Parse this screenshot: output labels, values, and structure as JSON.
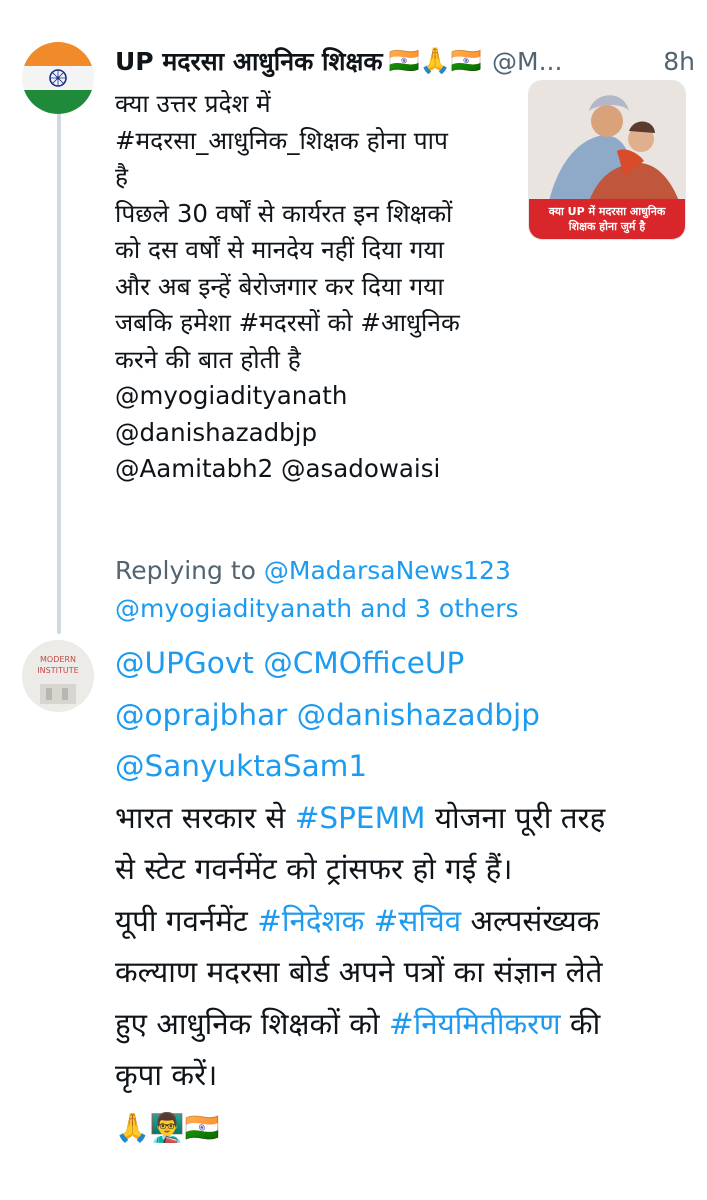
{
  "tweet": {
    "author_name": "UP मदरसा आधुनिक शिक्षक",
    "author_flags": "🇮🇳🙏🇮🇳",
    "handle": "@M...",
    "time": "8h",
    "text_lines": [
      "क्या उत्तर प्रदेश में",
      "#मदरसा_आधुनिक_शिक्षक होना पाप",
      "है",
      "पिछले 30 वर्षों से कार्यरत इन शिक्षकों",
      "को दस वर्षों से मानदेय नहीं दिया गया",
      "और अब इन्हें बेरोजगार कर दिया गया",
      "जबकि हमेशा #मदरसों को #आधुनिक",
      "करने की बात होती है",
      "@myogiadityanath",
      "@danishazadbjp",
      "@Aamitabh2 @asadowaisi"
    ],
    "image_caption_line1": "क्या UP में मदरसा आधुनिक",
    "image_caption_line2": "शिक्षक होना जुर्म है"
  },
  "reply": {
    "avatar_text_line1": "MODERN",
    "avatar_text_line2": "INSTITUTE",
    "replying_prefix": "Replying to ",
    "replying_to_1": "@MadarsaNews123",
    "replying_to_2": "@myogiadityanath and 3 others",
    "mentions_line1": "@UPGovt @CMOfficeUP",
    "mentions_line2": "@oprajbhar @danishazadbjp",
    "mentions_line3": "@SanyuktaSam1",
    "l4_a": "भारत सरकार से ",
    "l4_tag": "#SPEMM",
    "l4_b": " योजना पूरी तरह",
    "l5": "से स्टेट गवर्नमेंट को ट्रांसफर हो गई हैं।",
    "l6_a": "यूपी गवर्नमेंट ",
    "l6_tag1": "#निदेशक",
    "l6_tag2": "#सचिव",
    "l6_b": " अल्पसंख्यक",
    "l7": "कल्याण मदरसा बोर्ड अपने पत्रों का संज्ञान लेते",
    "l8_a": "हुए आधुनिक शिक्षकों को ",
    "l8_tag": "#नियमितीकरण",
    "l8_b": " की",
    "l9": "कृपा करें।",
    "emojis": "🙏👨‍🏫🇮🇳"
  },
  "colors": {
    "link": "#1d9bf0",
    "secondary": "#536471",
    "text": "#0f1419",
    "thread_line": "#cfd9de"
  }
}
